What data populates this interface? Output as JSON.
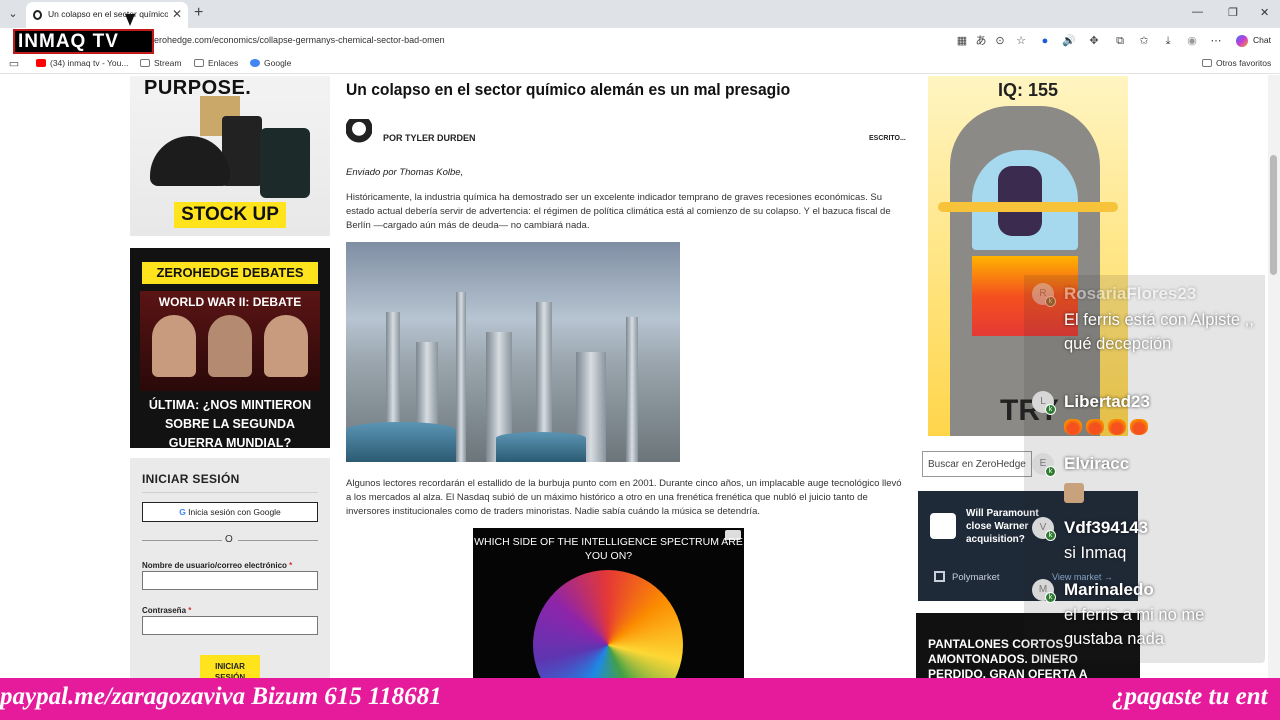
{
  "browser": {
    "tab_title": "Un colapso en el sector químico a",
    "tab_close": "✕",
    "new_tab": "+",
    "url": "erohedge.com/economics/collapse-germanys-chemical-sector-bad-omen",
    "chat_label": "Chat",
    "window_controls": [
      "—",
      "❐",
      "✕"
    ],
    "favorites": [
      {
        "label": "(34) inmaq tv - You...",
        "icon": "youtube-icon",
        "color": "#ff0000"
      },
      {
        "label": "Stream",
        "icon": "folder-icon",
        "color": "#777777"
      },
      {
        "label": "Enlaces",
        "icon": "folder-icon",
        "color": "#777777"
      },
      {
        "label": "Google",
        "icon": "google-icon",
        "color": "#4285f4"
      }
    ],
    "other_favorites": "Otros favoritos"
  },
  "overlay": {
    "logo_text": "INMAQ TV",
    "ticker_left": "paypal.me/zaragozaviva Bizum 615 118681",
    "ticker_right": "¿pagaste tu ent",
    "ticker_color": "#e61b9b"
  },
  "left_ads": {
    "purpose": "PURPOSE.",
    "stock_up": "STOCK UP",
    "debates_title": "ZEROHEDGE DEBATES",
    "debates_subtitle": "WORLD WAR II: DEBATE",
    "debates_question": "ÚLTIMA: ¿NOS MINTIERON SOBRE LA SEGUNDA GUERRA MUNDIAL?"
  },
  "login": {
    "title": "INICIAR SESIÓN",
    "google_button": "Inicia sesión con Google",
    "or": "O",
    "username_label": "Nombre de usuario/correo electrónico",
    "password_label": "Contraseña",
    "required_mark": "*",
    "submit": "INICIAR SESIÓN"
  },
  "article": {
    "title": "Un colapso en el sector químico alemán es un mal presagio",
    "author": "POR TYLER DURDEN",
    "written": "ESCRITO...",
    "sent_by": "Enviado por Thomas Kolbe,",
    "paragraph1": "Históricamente, la industria química ha demostrado ser un excelente indicador temprano de graves recesiones económicas. Su estado actual debería servir de advertencia: el régimen de política climática está al comienzo de su colapso. Y el bazuca fiscal de Berlín —cargado aún más de deuda— no cambiará nada.",
    "paragraph2": "Algunos lectores recordarán el estallido de la burbuja punto com en 2001. Durante cinco años, un implacable auge tecnológico llevó a los mercados al alza. El Nasdaq subió de un máximo histórico a otro en una frenética frenética que nubló el juicio tanto de inversores institucionales como de traders minoristas. Nadie sabía cuándo la música se detendría.",
    "ad_question": "WHICH SIDE OF THE INTELLIGENCE SPECTRUM ARE YOU ON?"
  },
  "right_ads": {
    "game_iq": "IQ: 155",
    "game_try": "TRY",
    "search_placeholder": "Buscar en ZeroHedge",
    "poly_question": "Will Paramount close Warner acquisition?",
    "poly_name": "Polymarket",
    "poly_view": "View market →",
    "shorts_text": "PANTALONES CORTOS AMONTONADOS. DINERO PERDIDO. GRAN OFERTA A PUNTO DE"
  },
  "chat": [
    {
      "user": "RosariaFlores23",
      "avatar": "R",
      "text": "El ferris está con Alpiste ,, qué decepción"
    },
    {
      "user": "Libertad23",
      "avatar": "L",
      "text": ""
    },
    {
      "user": "Elviracc",
      "avatar": "E",
      "text": ""
    },
    {
      "user": "Vdf394143",
      "avatar": "V",
      "text": "si Inmaq"
    },
    {
      "user": "Marinaledo",
      "avatar": "M",
      "text": "el ferris a mi no me gustaba nada"
    }
  ]
}
